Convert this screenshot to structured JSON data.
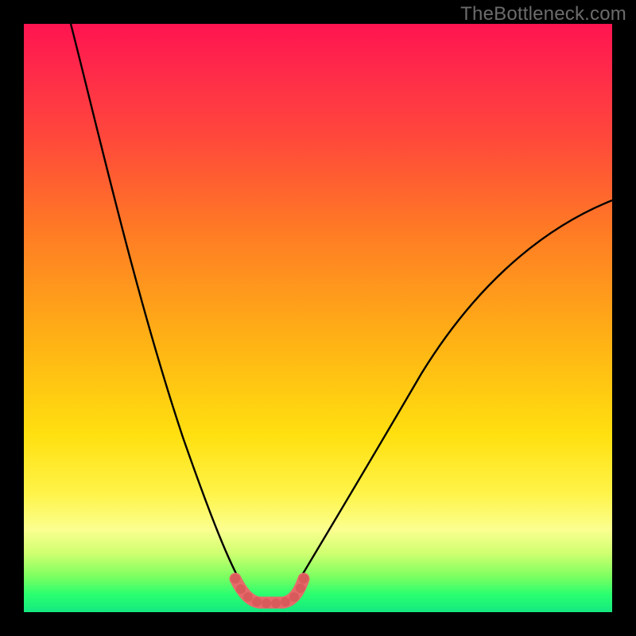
{
  "watermark": "TheBottleneck.com",
  "colors": {
    "frame": "#000000",
    "gradient_top": "#ff1450",
    "gradient_bottom": "#14e880",
    "curve": "#000000",
    "highlight": "#e76a6a"
  },
  "chart_data": {
    "type": "line",
    "title": "",
    "xlabel": "",
    "ylabel": "",
    "xlim": [
      0,
      100
    ],
    "ylim": [
      0,
      100
    ],
    "series": [
      {
        "name": "left-branch",
        "x": [
          8,
          10,
          12,
          14,
          16,
          18,
          20,
          22,
          24,
          26,
          28,
          30,
          32,
          34,
          36,
          37.5
        ],
        "values": [
          100,
          89,
          79,
          70,
          62,
          54,
          47,
          40,
          34,
          28,
          23,
          18,
          13.5,
          9.5,
          6,
          4
        ]
      },
      {
        "name": "right-branch",
        "x": [
          46,
          48,
          52,
          56,
          60,
          64,
          68,
          72,
          76,
          80,
          84,
          88,
          92,
          96,
          100
        ],
        "values": [
          4,
          6,
          10,
          15,
          20,
          25.5,
          31,
          36.5,
          42,
          47,
          52,
          57,
          61.5,
          66,
          70
        ]
      },
      {
        "name": "trough-highlight",
        "x": [
          36,
          37.5,
          39,
          41,
          43,
          45,
          46,
          47.5
        ],
        "values": [
          5.5,
          4,
          2.5,
          2,
          2,
          2.5,
          4,
          5.5
        ]
      }
    ]
  }
}
